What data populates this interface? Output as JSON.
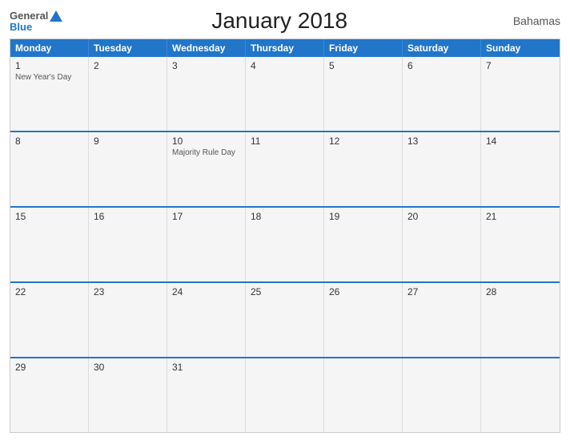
{
  "header": {
    "title": "January 2018",
    "country": "Bahamas",
    "logo_general": "General",
    "logo_blue": "Blue"
  },
  "days_of_week": [
    "Monday",
    "Tuesday",
    "Wednesday",
    "Thursday",
    "Friday",
    "Saturday",
    "Sunday"
  ],
  "weeks": [
    [
      {
        "num": "1",
        "holiday": "New Year's Day"
      },
      {
        "num": "2",
        "holiday": ""
      },
      {
        "num": "3",
        "holiday": ""
      },
      {
        "num": "4",
        "holiday": ""
      },
      {
        "num": "5",
        "holiday": ""
      },
      {
        "num": "6",
        "holiday": ""
      },
      {
        "num": "7",
        "holiday": ""
      }
    ],
    [
      {
        "num": "8",
        "holiday": ""
      },
      {
        "num": "9",
        "holiday": ""
      },
      {
        "num": "10",
        "holiday": "Majority Rule Day"
      },
      {
        "num": "11",
        "holiday": ""
      },
      {
        "num": "12",
        "holiday": ""
      },
      {
        "num": "13",
        "holiday": ""
      },
      {
        "num": "14",
        "holiday": ""
      }
    ],
    [
      {
        "num": "15",
        "holiday": ""
      },
      {
        "num": "16",
        "holiday": ""
      },
      {
        "num": "17",
        "holiday": ""
      },
      {
        "num": "18",
        "holiday": ""
      },
      {
        "num": "19",
        "holiday": ""
      },
      {
        "num": "20",
        "holiday": ""
      },
      {
        "num": "21",
        "holiday": ""
      }
    ],
    [
      {
        "num": "22",
        "holiday": ""
      },
      {
        "num": "23",
        "holiday": ""
      },
      {
        "num": "24",
        "holiday": ""
      },
      {
        "num": "25",
        "holiday": ""
      },
      {
        "num": "26",
        "holiday": ""
      },
      {
        "num": "27",
        "holiday": ""
      },
      {
        "num": "28",
        "holiday": ""
      }
    ],
    [
      {
        "num": "29",
        "holiday": ""
      },
      {
        "num": "30",
        "holiday": ""
      },
      {
        "num": "31",
        "holiday": ""
      },
      {
        "num": "",
        "holiday": ""
      },
      {
        "num": "",
        "holiday": ""
      },
      {
        "num": "",
        "holiday": ""
      },
      {
        "num": "",
        "holiday": ""
      }
    ]
  ]
}
